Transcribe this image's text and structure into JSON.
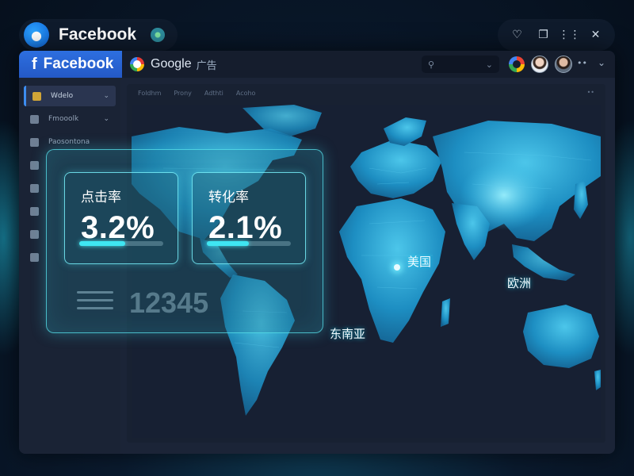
{
  "app": {
    "title": "Facebook",
    "accent": "#2d6fe0"
  },
  "window_controls": [
    "shield-heart-icon",
    "restore-icon",
    "signal-icon",
    "close-icon"
  ],
  "tabs": {
    "facebook_tab": "Facebook",
    "google_tab": "Google",
    "google_tab_sub": "广告"
  },
  "sidebar": {
    "items": [
      {
        "label": "Wdelo",
        "icon": "dashboard-icon",
        "active": true
      },
      {
        "label": "Fmooolk",
        "icon": "home-icon"
      },
      {
        "label": "Paosontona",
        "icon": "folder-icon"
      },
      {
        "label": "",
        "icon": "document-icon"
      },
      {
        "label": "",
        "icon": "briefcase-icon"
      },
      {
        "label": "",
        "icon": "mail-icon"
      },
      {
        "label": "",
        "icon": "globe-icon"
      },
      {
        "label": "",
        "icon": "settings-icon"
      }
    ]
  },
  "map_header": [
    "Foldhm",
    "Prony",
    "Adthti",
    "Acoho"
  ],
  "map": {
    "regions": {
      "usa": "美国",
      "europe": "欧洲",
      "southeast_asia": "东南亚"
    }
  },
  "stats": [
    {
      "label": "点击率",
      "value": "3.2%",
      "progress": 0.55
    },
    {
      "label": "转化率",
      "value": "2.1%",
      "progress": 0.5
    }
  ],
  "ghost_number": "12345",
  "colors": {
    "highlight": "#3fe6f2",
    "map_land": "#1f8fc4",
    "background": "#0a1a2e"
  }
}
